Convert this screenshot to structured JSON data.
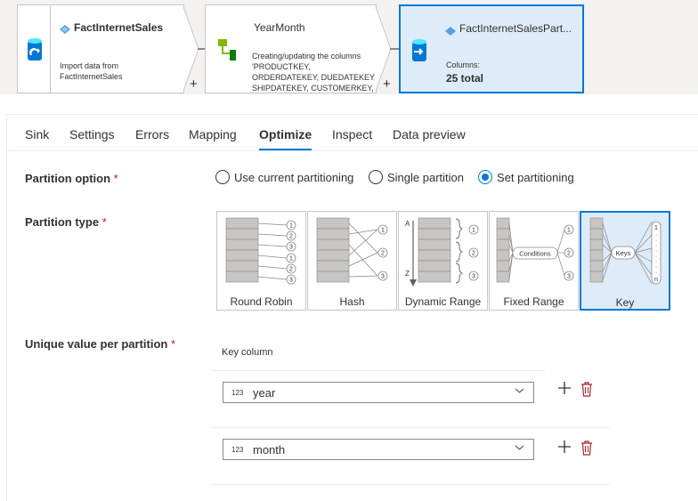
{
  "flow": {
    "source": {
      "title": "FactInternetSales",
      "description": "Import data from FactInternetSales"
    },
    "derived": {
      "title": "YearMonth",
      "description": "Creating/updating the columns 'PRODUCTKEY, ORDERDATEKEY, DUEDATEKEY, SHIPDATEKEY, CUSTOMERKEY,"
    },
    "sink": {
      "title": "FactInternetSalesPart...",
      "columns_label": "Columns:",
      "columns_value": "25 total"
    },
    "plus": "+"
  },
  "tabs": [
    "Sink",
    "Settings",
    "Errors",
    "Mapping",
    "Optimize",
    "Inspect",
    "Data preview"
  ],
  "active_tab": "Optimize",
  "partition_option": {
    "label": "Partition option",
    "required": "*",
    "options": [
      "Use current partitioning",
      "Single partition",
      "Set partitioning"
    ],
    "selected": "Set partitioning"
  },
  "partition_type": {
    "label": "Partition type",
    "required": "*",
    "types": [
      "Round Robin",
      "Hash",
      "Dynamic Range",
      "Fixed Range",
      "Key"
    ],
    "selected": "Key",
    "diagram_text": {
      "conditions": "Conditions",
      "keys": "Keys",
      "a": "A",
      "z": "Z",
      "n": "n"
    }
  },
  "unique_value": {
    "label": "Unique value per partition",
    "required": "*",
    "key_column_header": "Key column",
    "rows": [
      {
        "type_badge": "123",
        "value": "year"
      },
      {
        "type_badge": "123",
        "value": "month"
      }
    ]
  },
  "colors": {
    "accent": "#0078d4",
    "selected_bg": "#deecf9",
    "required": "#a4262c"
  }
}
